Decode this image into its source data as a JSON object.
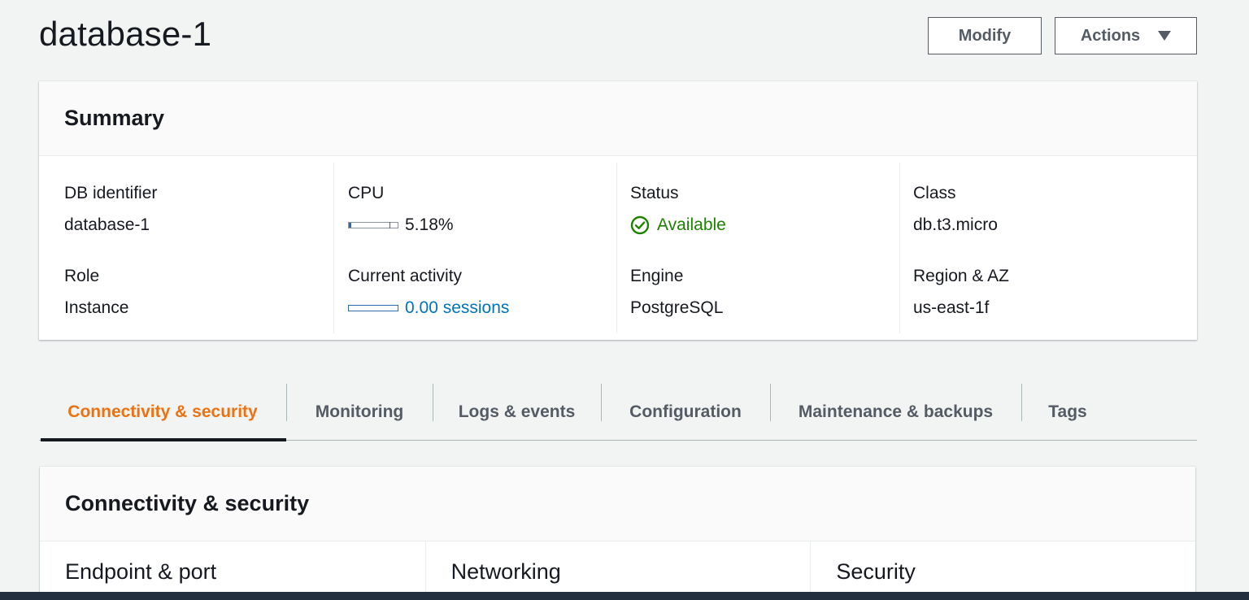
{
  "page": {
    "title": "database-1"
  },
  "header_buttons": {
    "modify": "Modify",
    "actions": "Actions"
  },
  "summary": {
    "title": "Summary",
    "columns": [
      {
        "items": [
          {
            "key": "DB identifier",
            "value": "database-1"
          },
          {
            "key": "Role",
            "value": "Instance"
          }
        ]
      },
      {
        "items": [
          {
            "key": "CPU",
            "value": "5.18%"
          },
          {
            "key": "Current activity",
            "value": "0.00 sessions"
          }
        ]
      },
      {
        "items": [
          {
            "key": "Status",
            "value": "Available"
          },
          {
            "key": "Engine",
            "value": "PostgreSQL"
          }
        ]
      },
      {
        "items": [
          {
            "key": "Class",
            "value": "db.t3.micro"
          },
          {
            "key": "Region & AZ",
            "value": "us-east-1f"
          }
        ]
      }
    ],
    "cpu_percent": 5.18,
    "sessions": 0.0
  },
  "tabs": [
    {
      "label": "Connectivity & security",
      "active": true
    },
    {
      "label": "Monitoring",
      "active": false
    },
    {
      "label": "Logs & events",
      "active": false
    },
    {
      "label": "Configuration",
      "active": false
    },
    {
      "label": "Maintenance & backups",
      "active": false
    },
    {
      "label": "Tags",
      "active": false
    }
  ],
  "connectivity": {
    "title": "Connectivity & security",
    "sections": [
      "Endpoint & port",
      "Networking",
      "Security"
    ]
  },
  "colors": {
    "accent_tab": "#ec7211",
    "status_ok": "#1d8102",
    "link": "#0073bb",
    "bar_fill": "#2e6cb0"
  },
  "icons": {
    "status": "check-circle-icon",
    "actions_caret": "caret-down-icon"
  }
}
